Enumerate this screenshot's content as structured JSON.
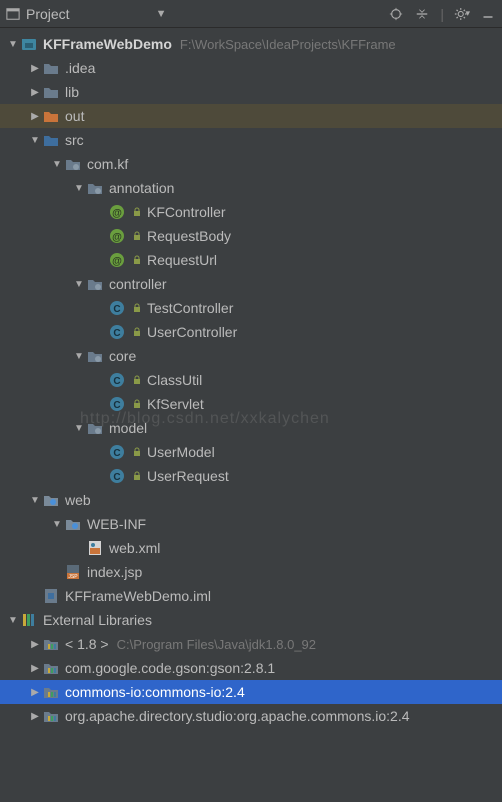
{
  "toolbar": {
    "title": "Project"
  },
  "tree": [
    {
      "depth": 0,
      "arrow": "down",
      "icon": "module",
      "label": "KFFrameWebDemo",
      "bold": true,
      "path": "F:\\WorkSpace\\IdeaProjects\\KFFrame",
      "name": "project-root"
    },
    {
      "depth": 1,
      "arrow": "right",
      "icon": "folder",
      "label": ".idea",
      "name": "folder-idea"
    },
    {
      "depth": 1,
      "arrow": "right",
      "icon": "folder",
      "label": "lib",
      "name": "folder-lib"
    },
    {
      "depth": 1,
      "arrow": "right",
      "icon": "folder-out",
      "label": "out",
      "name": "folder-out",
      "highlight": "out"
    },
    {
      "depth": 1,
      "arrow": "down",
      "icon": "folder-src",
      "label": "src",
      "name": "folder-src"
    },
    {
      "depth": 2,
      "arrow": "down",
      "icon": "package",
      "label": "com.kf",
      "name": "pkg-com-kf"
    },
    {
      "depth": 3,
      "arrow": "down",
      "icon": "package",
      "label": "annotation",
      "name": "pkg-annotation"
    },
    {
      "depth": 4,
      "arrow": "none",
      "icon": "anno",
      "sub": "lock",
      "label": "KFController",
      "name": "class-kfcontroller"
    },
    {
      "depth": 4,
      "arrow": "none",
      "icon": "anno",
      "sub": "lock",
      "label": "RequestBody",
      "name": "class-requestbody"
    },
    {
      "depth": 4,
      "arrow": "none",
      "icon": "anno",
      "sub": "lock",
      "label": "RequestUrl",
      "name": "class-requesturl"
    },
    {
      "depth": 3,
      "arrow": "down",
      "icon": "package",
      "label": "controller",
      "name": "pkg-controller"
    },
    {
      "depth": 4,
      "arrow": "none",
      "icon": "class",
      "sub": "lock",
      "label": "TestController",
      "name": "class-testcontroller"
    },
    {
      "depth": 4,
      "arrow": "none",
      "icon": "class",
      "sub": "lock",
      "label": "UserController",
      "name": "class-usercontroller"
    },
    {
      "depth": 3,
      "arrow": "down",
      "icon": "package",
      "label": "core",
      "name": "pkg-core"
    },
    {
      "depth": 4,
      "arrow": "none",
      "icon": "class",
      "sub": "lock",
      "label": "ClassUtil",
      "name": "class-classutil"
    },
    {
      "depth": 4,
      "arrow": "none",
      "icon": "class",
      "sub": "lock",
      "label": "KfServlet",
      "name": "class-kfservlet"
    },
    {
      "depth": 3,
      "arrow": "down",
      "icon": "package",
      "label": "model",
      "name": "pkg-model"
    },
    {
      "depth": 4,
      "arrow": "none",
      "icon": "class",
      "sub": "lock",
      "label": "UserModel",
      "name": "class-usermodel"
    },
    {
      "depth": 4,
      "arrow": "none",
      "icon": "class",
      "sub": "lock",
      "label": "UserRequest",
      "name": "class-userrequest"
    },
    {
      "depth": 1,
      "arrow": "down",
      "icon": "folder-web",
      "label": "web",
      "name": "folder-web"
    },
    {
      "depth": 2,
      "arrow": "down",
      "icon": "folder-web",
      "label": "WEB-INF",
      "name": "folder-webinf"
    },
    {
      "depth": 3,
      "arrow": "none",
      "icon": "xml",
      "label": "web.xml",
      "name": "file-webxml"
    },
    {
      "depth": 2,
      "arrow": "none",
      "icon": "jsp",
      "label": "index.jsp",
      "name": "file-indexjsp"
    },
    {
      "depth": 1,
      "arrow": "none",
      "icon": "iml",
      "label": "KFFrameWebDemo.iml",
      "name": "file-iml"
    },
    {
      "depth": 0,
      "arrow": "down",
      "icon": "libs",
      "label": "External Libraries",
      "name": "external-libraries"
    },
    {
      "depth": 1,
      "arrow": "right",
      "icon": "lib",
      "label": "< 1.8 >",
      "path": "C:\\Program Files\\Java\\jdk1.8.0_92",
      "name": "lib-jdk"
    },
    {
      "depth": 1,
      "arrow": "right",
      "icon": "lib",
      "label": "com.google.code.gson:gson:2.8.1",
      "name": "lib-gson"
    },
    {
      "depth": 1,
      "arrow": "right",
      "icon": "lib",
      "label": "commons-io:commons-io:2.4",
      "name": "lib-commons-io",
      "highlight": "blue"
    },
    {
      "depth": 1,
      "arrow": "right",
      "icon": "lib",
      "label": "org.apache.directory.studio:org.apache.commons.io:2.4",
      "name": "lib-apache-commons-io"
    }
  ],
  "watermark": "http://blog.csdn.net/xxkalychen"
}
